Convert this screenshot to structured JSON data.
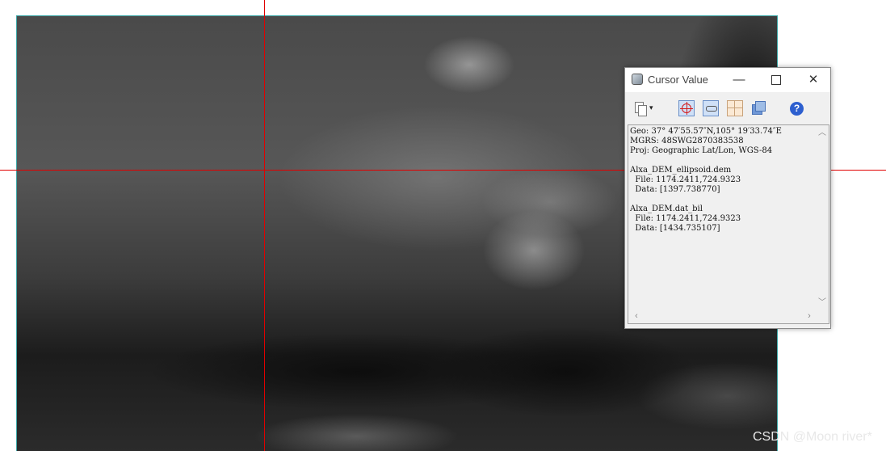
{
  "window": {
    "title": "Cursor Value",
    "controls": {
      "minimize": "—",
      "close": "✕"
    }
  },
  "toolbar": {
    "dropdown_glyph": "▾",
    "help_glyph": "?",
    "icons": [
      "copy-icon",
      "crosshair-icon",
      "link-icon",
      "grid-icon",
      "stack-icon",
      "help-icon"
    ]
  },
  "cursor_info": {
    "lines": [
      "Geo: 37° 47′55.57″N,105° 19′33.74″E",
      "MGRS: 48SWG2870383538",
      "Proj: Geographic Lat/Lon, WGS-84",
      "",
      "Alxa_DEM_ellipsoid.dem",
      "  File: 1174.2411,724.9323",
      "  Data: [1397.738770]",
      "",
      "Alxa_DEM.dat_bil",
      "  File: 1174.2411,724.9323",
      "  Data: [1434.735107]"
    ]
  },
  "scroll": {
    "up": "︿",
    "down": "﹀",
    "left": "‹",
    "right": "›"
  },
  "colors": {
    "crosshair": "#e00000",
    "raster_border": "#3aa6a6"
  },
  "watermark": "CSDN @Moon river*"
}
